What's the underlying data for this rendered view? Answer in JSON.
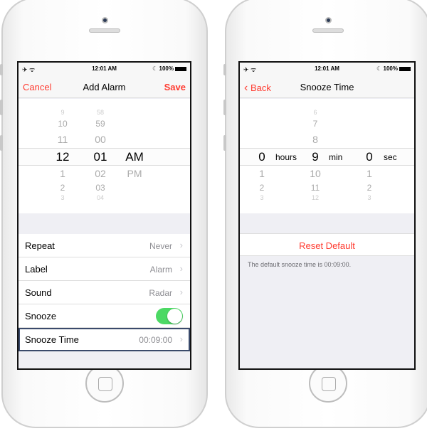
{
  "status": {
    "time": "12:01 AM",
    "battery": "100%"
  },
  "add_alarm": {
    "title": "Add Alarm",
    "cancel": "Cancel",
    "save": "Save",
    "hours": [
      "9",
      "10",
      "11",
      "12",
      "1",
      "2",
      "3"
    ],
    "minutes": [
      "58",
      "59",
      "00",
      "01",
      "02",
      "03",
      "04"
    ],
    "ampm": [
      "AM",
      "PM"
    ],
    "rows": [
      {
        "label": "Repeat",
        "value": "Never"
      },
      {
        "label": "Label",
        "value": "Alarm"
      },
      {
        "label": "Sound",
        "value": "Radar"
      },
      {
        "label": "Snooze",
        "toggle": true
      },
      {
        "label": "Snooze Time",
        "value": "00:09:00"
      }
    ]
  },
  "snooze": {
    "title": "Snooze Time",
    "back": "Back",
    "hours": [
      "0",
      "1",
      "2",
      "3"
    ],
    "hours_label": "hours",
    "mins": [
      "6",
      "7",
      "8",
      "9",
      "10",
      "11",
      "12"
    ],
    "min_label": "min",
    "secs": [
      "0",
      "1",
      "2",
      "3"
    ],
    "sec_label": "sec",
    "reset": "Reset Default",
    "footer": "The default snooze time is 00:09:00."
  }
}
